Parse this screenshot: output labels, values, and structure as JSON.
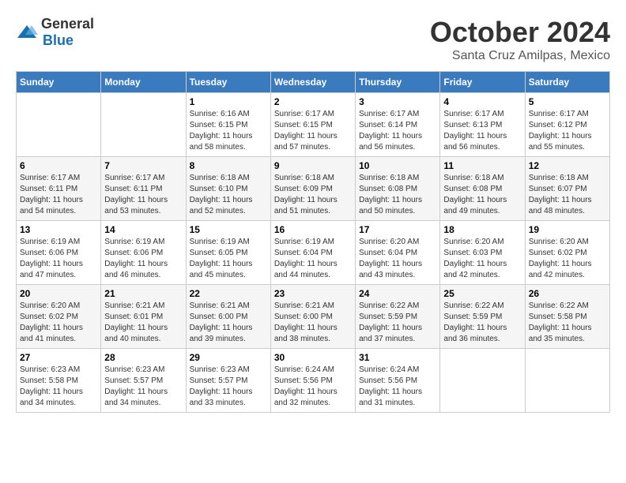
{
  "logo": {
    "text_general": "General",
    "text_blue": "Blue"
  },
  "title": {
    "month": "October 2024",
    "location": "Santa Cruz Amilpas, Mexico"
  },
  "headers": [
    "Sunday",
    "Monday",
    "Tuesday",
    "Wednesday",
    "Thursday",
    "Friday",
    "Saturday"
  ],
  "weeks": [
    [
      {
        "day": "",
        "info": ""
      },
      {
        "day": "",
        "info": ""
      },
      {
        "day": "1",
        "info": "Sunrise: 6:16 AM\nSunset: 6:15 PM\nDaylight: 11 hours and 58 minutes."
      },
      {
        "day": "2",
        "info": "Sunrise: 6:17 AM\nSunset: 6:15 PM\nDaylight: 11 hours and 57 minutes."
      },
      {
        "day": "3",
        "info": "Sunrise: 6:17 AM\nSunset: 6:14 PM\nDaylight: 11 hours and 56 minutes."
      },
      {
        "day": "4",
        "info": "Sunrise: 6:17 AM\nSunset: 6:13 PM\nDaylight: 11 hours and 56 minutes."
      },
      {
        "day": "5",
        "info": "Sunrise: 6:17 AM\nSunset: 6:12 PM\nDaylight: 11 hours and 55 minutes."
      }
    ],
    [
      {
        "day": "6",
        "info": "Sunrise: 6:17 AM\nSunset: 6:11 PM\nDaylight: 11 hours and 54 minutes."
      },
      {
        "day": "7",
        "info": "Sunrise: 6:17 AM\nSunset: 6:11 PM\nDaylight: 11 hours and 53 minutes."
      },
      {
        "day": "8",
        "info": "Sunrise: 6:18 AM\nSunset: 6:10 PM\nDaylight: 11 hours and 52 minutes."
      },
      {
        "day": "9",
        "info": "Sunrise: 6:18 AM\nSunset: 6:09 PM\nDaylight: 11 hours and 51 minutes."
      },
      {
        "day": "10",
        "info": "Sunrise: 6:18 AM\nSunset: 6:08 PM\nDaylight: 11 hours and 50 minutes."
      },
      {
        "day": "11",
        "info": "Sunrise: 6:18 AM\nSunset: 6:08 PM\nDaylight: 11 hours and 49 minutes."
      },
      {
        "day": "12",
        "info": "Sunrise: 6:18 AM\nSunset: 6:07 PM\nDaylight: 11 hours and 48 minutes."
      }
    ],
    [
      {
        "day": "13",
        "info": "Sunrise: 6:19 AM\nSunset: 6:06 PM\nDaylight: 11 hours and 47 minutes."
      },
      {
        "day": "14",
        "info": "Sunrise: 6:19 AM\nSunset: 6:06 PM\nDaylight: 11 hours and 46 minutes."
      },
      {
        "day": "15",
        "info": "Sunrise: 6:19 AM\nSunset: 6:05 PM\nDaylight: 11 hours and 45 minutes."
      },
      {
        "day": "16",
        "info": "Sunrise: 6:19 AM\nSunset: 6:04 PM\nDaylight: 11 hours and 44 minutes."
      },
      {
        "day": "17",
        "info": "Sunrise: 6:20 AM\nSunset: 6:04 PM\nDaylight: 11 hours and 43 minutes."
      },
      {
        "day": "18",
        "info": "Sunrise: 6:20 AM\nSunset: 6:03 PM\nDaylight: 11 hours and 42 minutes."
      },
      {
        "day": "19",
        "info": "Sunrise: 6:20 AM\nSunset: 6:02 PM\nDaylight: 11 hours and 42 minutes."
      }
    ],
    [
      {
        "day": "20",
        "info": "Sunrise: 6:20 AM\nSunset: 6:02 PM\nDaylight: 11 hours and 41 minutes."
      },
      {
        "day": "21",
        "info": "Sunrise: 6:21 AM\nSunset: 6:01 PM\nDaylight: 11 hours and 40 minutes."
      },
      {
        "day": "22",
        "info": "Sunrise: 6:21 AM\nSunset: 6:00 PM\nDaylight: 11 hours and 39 minutes."
      },
      {
        "day": "23",
        "info": "Sunrise: 6:21 AM\nSunset: 6:00 PM\nDaylight: 11 hours and 38 minutes."
      },
      {
        "day": "24",
        "info": "Sunrise: 6:22 AM\nSunset: 5:59 PM\nDaylight: 11 hours and 37 minutes."
      },
      {
        "day": "25",
        "info": "Sunrise: 6:22 AM\nSunset: 5:59 PM\nDaylight: 11 hours and 36 minutes."
      },
      {
        "day": "26",
        "info": "Sunrise: 6:22 AM\nSunset: 5:58 PM\nDaylight: 11 hours and 35 minutes."
      }
    ],
    [
      {
        "day": "27",
        "info": "Sunrise: 6:23 AM\nSunset: 5:58 PM\nDaylight: 11 hours and 34 minutes."
      },
      {
        "day": "28",
        "info": "Sunrise: 6:23 AM\nSunset: 5:57 PM\nDaylight: 11 hours and 34 minutes."
      },
      {
        "day": "29",
        "info": "Sunrise: 6:23 AM\nSunset: 5:57 PM\nDaylight: 11 hours and 33 minutes."
      },
      {
        "day": "30",
        "info": "Sunrise: 6:24 AM\nSunset: 5:56 PM\nDaylight: 11 hours and 32 minutes."
      },
      {
        "day": "31",
        "info": "Sunrise: 6:24 AM\nSunset: 5:56 PM\nDaylight: 11 hours and 31 minutes."
      },
      {
        "day": "",
        "info": ""
      },
      {
        "day": "",
        "info": ""
      }
    ]
  ]
}
